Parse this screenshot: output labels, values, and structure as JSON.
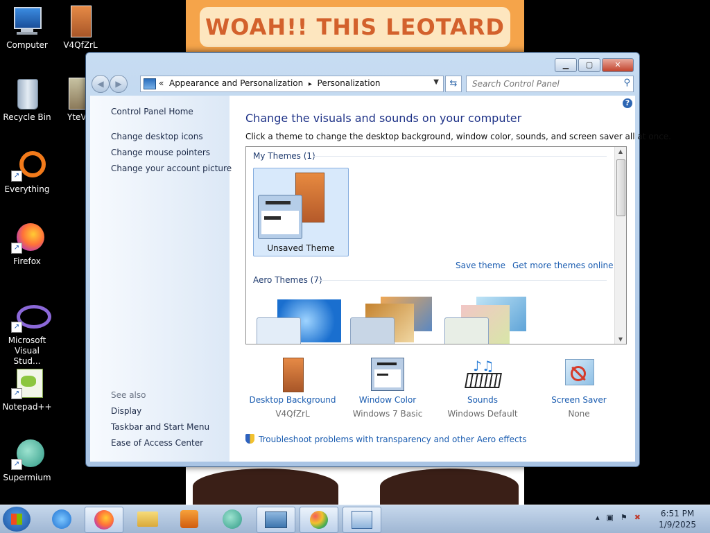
{
  "wallpaper": {
    "banner_text": "WOAH!! THIS LEOTARD"
  },
  "desktop_icons": [
    {
      "label": "Computer"
    },
    {
      "label": "V4QfZrL"
    },
    {
      "label": "Recycle Bin"
    },
    {
      "label": "YteV"
    },
    {
      "label": "Everything"
    },
    {
      "label": "Firefox"
    },
    {
      "label": "Microsoft Visual Stud..."
    },
    {
      "label": "Notepad++"
    },
    {
      "label": "Supermium"
    }
  ],
  "window": {
    "address": {
      "overflow": "«",
      "crumb1": "Appearance and Personalization",
      "separator": "▸",
      "crumb2": "Personalization"
    },
    "search_placeholder": "Search Control Panel",
    "left_pane": {
      "home": "Control Panel Home",
      "links": [
        "Change desktop icons",
        "Change mouse pointers",
        "Change your account picture"
      ],
      "see_also": "See also",
      "see_also_links": [
        "Display",
        "Taskbar and Start Menu",
        "Ease of Access Center"
      ]
    },
    "title": "Change the visuals and sounds on your computer",
    "subtitle": "Click a theme to change the desktop background, window color, sounds, and screen saver all at once.",
    "my_themes_header": "My Themes (1)",
    "unsaved_theme": "Unsaved Theme",
    "save_theme": "Save theme",
    "get_more": "Get more themes online",
    "aero_header": "Aero Themes (7)",
    "bottom_items": [
      {
        "title": "Desktop Background",
        "value": "V4QfZrL"
      },
      {
        "title": "Window Color",
        "value": "Windows 7 Basic"
      },
      {
        "title": "Sounds",
        "value": "Windows Default"
      },
      {
        "title": "Screen Saver",
        "value": "None"
      }
    ],
    "troubleshoot": "Troubleshoot problems with transparency and other Aero effects"
  },
  "taskbar": {
    "apps": [
      "internet-explorer",
      "firefox",
      "file-explorer",
      "media-player",
      "supermium",
      "remote-desktop",
      "paint",
      "control-panel"
    ],
    "time": "6:51 PM",
    "date": "1/9/2025"
  }
}
